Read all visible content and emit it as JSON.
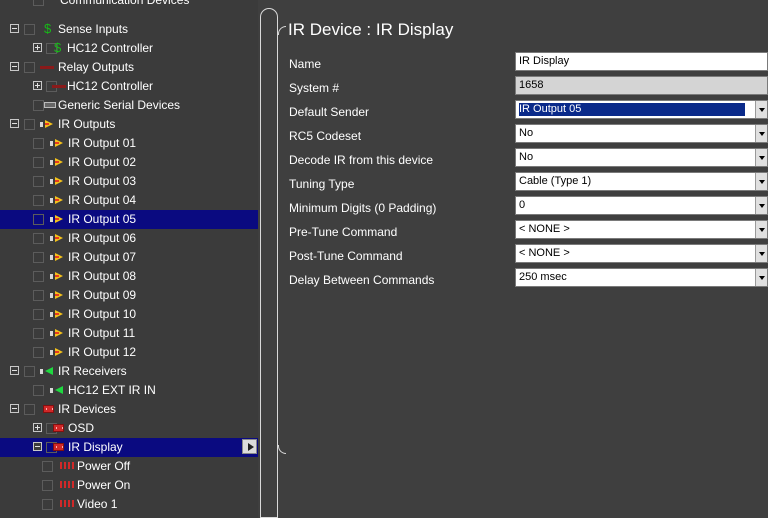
{
  "tree": {
    "items": [
      {
        "label": "Communication Devices"
      },
      {
        "label": "Sense Inputs"
      },
      {
        "label": "HC12 Controller"
      },
      {
        "label": "Relay Outputs"
      },
      {
        "label": "HC12 Controller"
      },
      {
        "label": "Generic Serial Devices"
      },
      {
        "label": "IR Outputs"
      },
      {
        "label": "IR Output 01"
      },
      {
        "label": "IR Output 02"
      },
      {
        "label": "IR Output 03"
      },
      {
        "label": "IR Output 04"
      },
      {
        "label": "IR Output 05"
      },
      {
        "label": "IR Output 06"
      },
      {
        "label": "IR Output 07"
      },
      {
        "label": "IR Output 08"
      },
      {
        "label": "IR Output 09"
      },
      {
        "label": "IR Output 10"
      },
      {
        "label": "IR Output 11"
      },
      {
        "label": "IR Output 12"
      },
      {
        "label": "IR Receivers"
      },
      {
        "label": "HC12 EXT IR IN"
      },
      {
        "label": "IR Devices"
      },
      {
        "label": "OSD"
      },
      {
        "label": "IR Display"
      },
      {
        "label": "Power Off"
      },
      {
        "label": "Power On"
      },
      {
        "label": "Video 1"
      }
    ]
  },
  "panel": {
    "title": "IR Device : IR Display",
    "fields": [
      {
        "label": "Name",
        "value": "IR Display"
      },
      {
        "label": "System #",
        "value": "1658"
      },
      {
        "label": "Default Sender",
        "value": "IR Output 05"
      },
      {
        "label": "RC5 Codeset",
        "value": "No"
      },
      {
        "label": "Decode IR from this device",
        "value": "No"
      },
      {
        "label": "Tuning Type",
        "value": "Cable (Type 1)"
      },
      {
        "label": "Minimum Digits (0 Padding)",
        "value": "0"
      },
      {
        "label": "Pre-Tune Command",
        "value": "< NONE >"
      },
      {
        "label": "Post-Tune Command",
        "value": "< NONE >"
      },
      {
        "label": "Delay Between Commands",
        "value": "250 msec"
      }
    ]
  },
  "colors": {
    "background": "#3f3f3f",
    "selection": "#0a0a80",
    "text": "#ffffff"
  }
}
